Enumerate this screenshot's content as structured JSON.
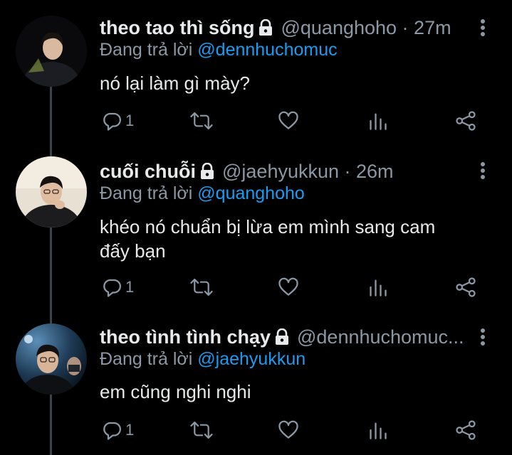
{
  "tweets": [
    {
      "name": "theo tao thì sống",
      "handle": "@quanghoho",
      "separator": " · ",
      "time": "27m",
      "reply_prefix": "Đang trả lời ",
      "reply_to": "@dennhuchomuc",
      "text": "nó lại làm gì mày?",
      "reply_count": "1"
    },
    {
      "name": "cuối chuỗi",
      "handle": "@jaehyukkun",
      "separator": " · ",
      "time": "26m",
      "reply_prefix": "Đang trả lời ",
      "reply_to": "@quanghoho",
      "text": "khéo nó chuẩn bị lừa em mình sang cam đấy bạn",
      "reply_count": "1"
    },
    {
      "name": "theo tình tình chạy",
      "handle": "@dennhuchomuc...",
      "separator": "",
      "time": "",
      "reply_prefix": "Đang trả lời ",
      "reply_to": "@jaehyukkun",
      "text": "em cũng nghi nghi",
      "reply_count": "1"
    }
  ],
  "icons": {
    "lock": "lock-icon",
    "more": "more-vertical-icon",
    "reply": "reply-icon",
    "retweet": "retweet-icon",
    "like": "heart-icon",
    "analytics": "analytics-icon",
    "share": "share-icon"
  },
  "colors": {
    "background": "#000000",
    "text": "#e7e9ea",
    "secondary": "#8b98a5",
    "mention": "#1d9bf0",
    "thread_line": "#3d4248"
  }
}
